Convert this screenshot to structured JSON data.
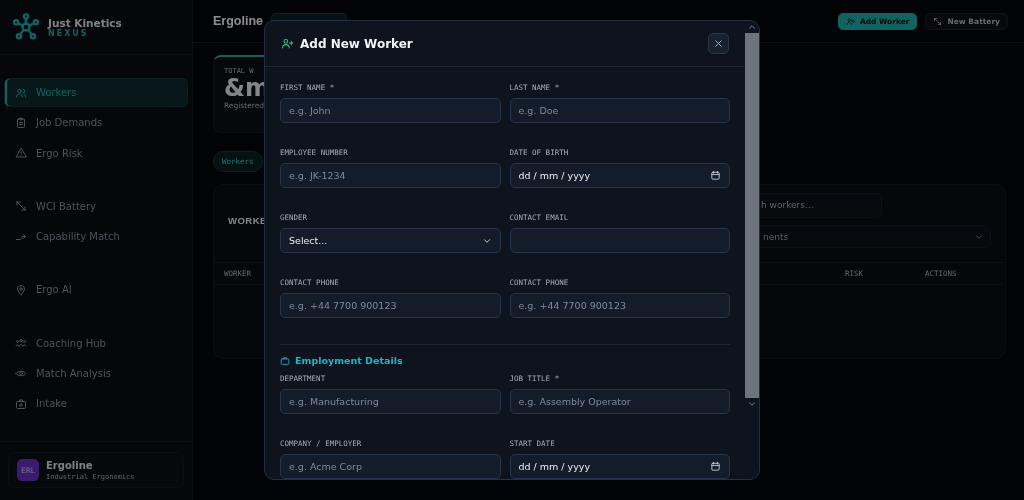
{
  "sidebar": {
    "brand": {
      "name": "Just Kinetics",
      "product": "NEXUS"
    },
    "sections": [
      {
        "items": [
          {
            "label": "Workers",
            "selected": true
          },
          {
            "label": "Job Demands",
            "selected": false
          },
          {
            "label": "Ergo Risk",
            "selected": false
          }
        ]
      },
      {
        "items": [
          {
            "label": "WCI Battery",
            "selected": false
          },
          {
            "label": "Capability Match",
            "selected": false
          }
        ]
      },
      {
        "items": [
          {
            "label": "Ergo AI",
            "selected": false
          }
        ]
      },
      {
        "items": [
          {
            "label": "Coaching Hub",
            "selected": false
          },
          {
            "label": "Match Analysis",
            "selected": false
          },
          {
            "label": "Intake",
            "selected": false
          }
        ]
      }
    ],
    "workspace": {
      "initials": "ERL",
      "name": "Ergoline",
      "subtitle": "Industrial Ergonomics"
    }
  },
  "header": {
    "title": "Ergoline",
    "buttons": [
      {
        "label": "Add Worker",
        "kind": "primary"
      },
      {
        "label": "New Battery",
        "kind": "secondary"
      }
    ]
  },
  "stat": {
    "label": "TOTAL W",
    "value": "&m",
    "caption": "Registered"
  },
  "chip": "Workers",
  "card": {
    "title": "WORKE",
    "search": "h workers...",
    "filter": "nents",
    "columns": [
      "WORKER",
      "RISK",
      "ACTIONS"
    ]
  },
  "modal": {
    "title": "Add New Worker",
    "sections": [
      {
        "fields": [
          {
            "label": "FIRST NAME *",
            "kind": "text",
            "placeholder": "e.g. John"
          },
          {
            "label": "LAST NAME *",
            "kind": "text",
            "placeholder": "e.g. Doe"
          },
          {
            "label": "EMPLOYEE NUMBER",
            "kind": "text",
            "placeholder": "e.g. JK-1234"
          },
          {
            "label": "DATE OF BIRTH",
            "kind": "date",
            "value": "dd / mm / yyyy"
          },
          {
            "label": "GENDER",
            "kind": "select",
            "value": "Select..."
          },
          {
            "label": "CONTACT EMAIL",
            "kind": "text"
          },
          {
            "label": "CONTACT PHONE",
            "kind": "text",
            "placeholder": "e.g. +44 7700 900123"
          },
          {
            "label": "CONTACT PHONE",
            "kind": "text",
            "placeholder": "e.g. +44 7700 900123"
          }
        ]
      },
      {
        "heading": "Employment Details",
        "fields": [
          {
            "label": "DEPARTMENT",
            "kind": "text",
            "placeholder": "e.g. Manufacturing"
          },
          {
            "label": "JOB TITLE *",
            "kind": "text",
            "placeholder": "e.g. Assembly Operator"
          },
          {
            "label": "COMPANY / EMPLOYER",
            "kind": "text",
            "placeholder": "e.g. Acme Corp"
          },
          {
            "label": "START DATE",
            "kind": "date",
            "value": "dd / mm / yyyy"
          }
        ]
      }
    ]
  }
}
